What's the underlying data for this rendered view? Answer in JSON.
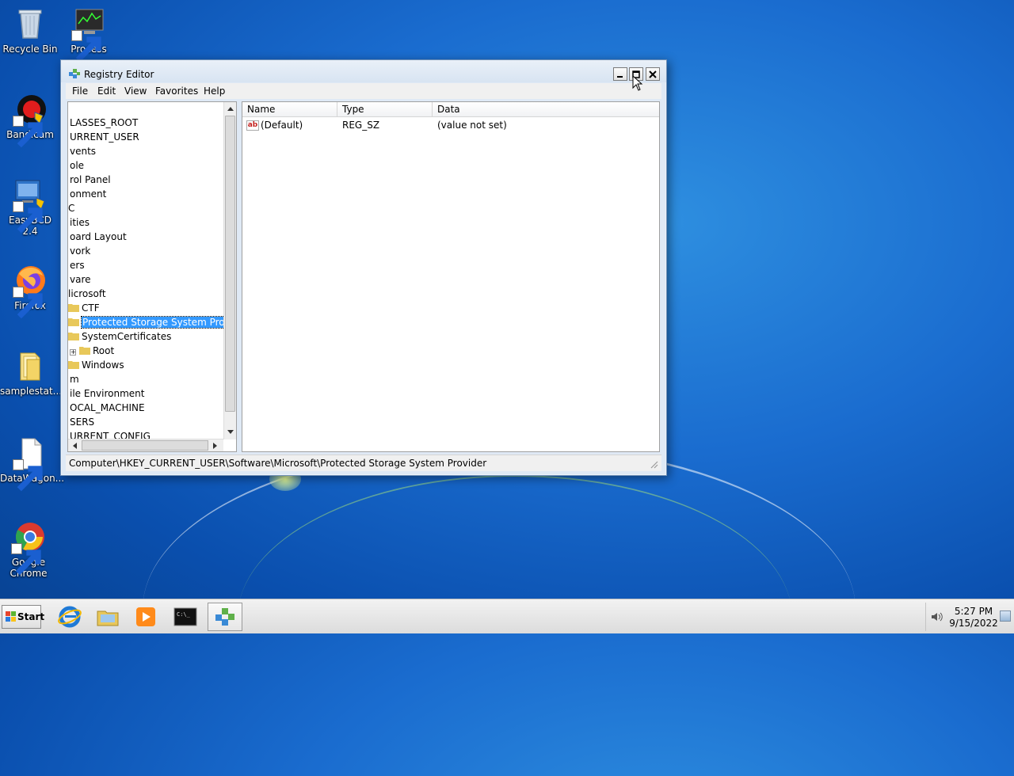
{
  "desktop": {
    "icons": [
      {
        "label": "Recycle Bin"
      },
      {
        "label": "Process"
      },
      {
        "label": "Bandicam"
      },
      {
        "label": "EasyBCD 2.4"
      },
      {
        "label": "Firefox"
      },
      {
        "label": "samplestat..."
      },
      {
        "label": "DataWagon..."
      },
      {
        "label": "Google Chrome"
      }
    ]
  },
  "window": {
    "title": "Registry Editor",
    "menu": [
      "File",
      "Edit",
      "View",
      "Favorites",
      "Help"
    ],
    "tree": [
      {
        "label": "LASSES_ROOT"
      },
      {
        "label": "URRENT_USER"
      },
      {
        "label": "vents"
      },
      {
        "label": "ole"
      },
      {
        "label": "rol Panel"
      },
      {
        "label": "onment"
      },
      {
        "label": "C"
      },
      {
        "label": "ities"
      },
      {
        "label": "oard Layout"
      },
      {
        "label": "vork"
      },
      {
        "label": "ers"
      },
      {
        "label": "vare"
      },
      {
        "label": "licrosoft"
      },
      {
        "label": "CTF"
      },
      {
        "label": "Protected Storage System Provider"
      },
      {
        "label": "SystemCertificates"
      },
      {
        "label": "Root"
      },
      {
        "label": "Windows"
      },
      {
        "label": "m"
      },
      {
        "label": "ile Environment"
      },
      {
        "label": "OCAL_MACHINE"
      },
      {
        "label": "SERS"
      },
      {
        "label": "URRENT_CONFIG"
      }
    ],
    "list": {
      "columns": [
        "Name",
        "Type",
        "Data"
      ],
      "rows": [
        {
          "name": "(Default)",
          "type": "REG_SZ",
          "data": "(value not set)"
        }
      ]
    },
    "status_path": "Computer\\HKEY_CURRENT_USER\\Software\\Microsoft\\Protected Storage System Provider"
  },
  "taskbar": {
    "start_label": "Start",
    "clock_time": "5:27 PM",
    "clock_date": "9/15/2022"
  }
}
